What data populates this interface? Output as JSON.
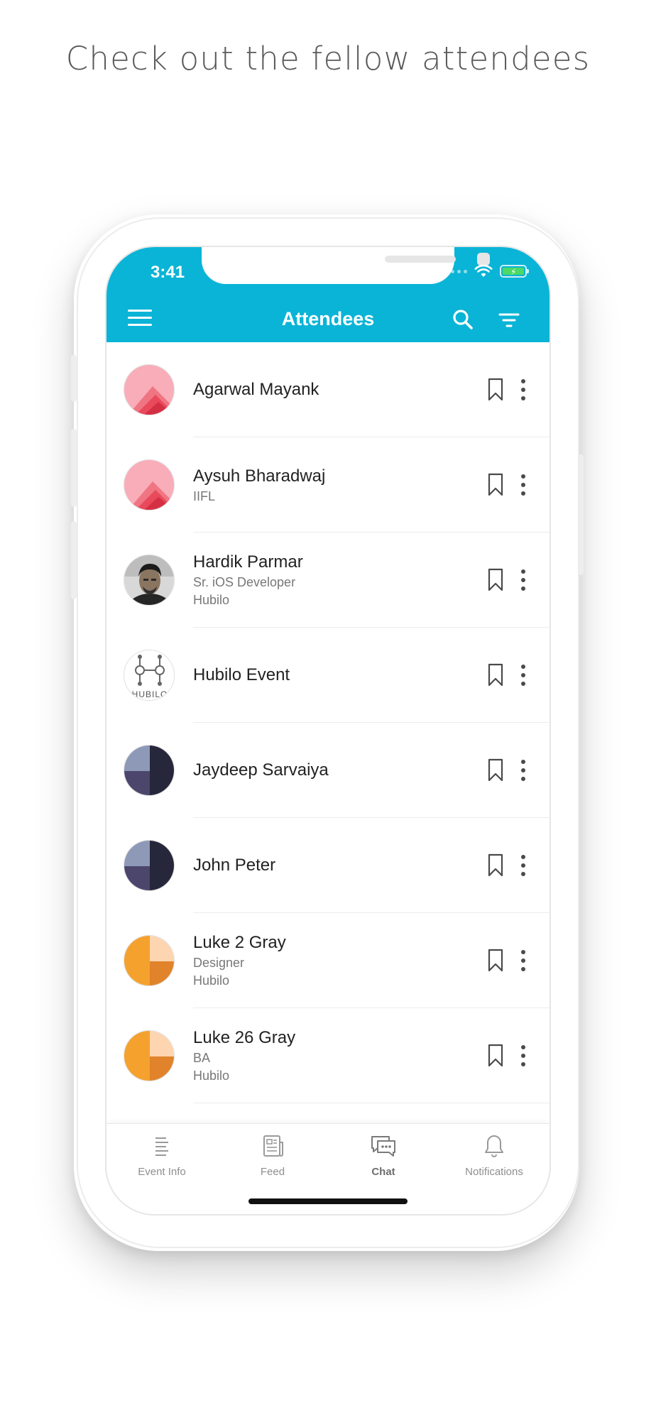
{
  "headline": "Check out the fellow attendees",
  "status_bar": {
    "time": "3:41"
  },
  "app_bar": {
    "title": "Attendees"
  },
  "colors": {
    "primary": "#0ab4d6",
    "text_primary": "#222222",
    "text_secondary": "#777777"
  },
  "attendees": [
    {
      "name": "Agarwal Mayank",
      "line1": "",
      "line2": "",
      "avatar": "pink-mountain-avatar"
    },
    {
      "name": "Aysuh Bharadwaj",
      "line1": "IIFL",
      "line2": "",
      "avatar": "pink-mountain-avatar"
    },
    {
      "name": "Hardik Parmar",
      "line1": "Sr. iOS Developer",
      "line2": "Hubilo",
      "avatar": "photo-avatar"
    },
    {
      "name": "Hubilo Event",
      "line1": "",
      "line2": "",
      "avatar": "hubilo-logo-avatar",
      "logo_text": "HUBILO"
    },
    {
      "name": "Jaydeep Sarvaiya",
      "line1": "",
      "line2": "",
      "avatar": "navy-quadrant-avatar"
    },
    {
      "name": "John Peter",
      "line1": "",
      "line2": "",
      "avatar": "navy-quadrant-avatar"
    },
    {
      "name": "Luke 2 Gray",
      "line1": "Designer",
      "line2": "Hubilo",
      "avatar": "orange-quadrant-avatar"
    },
    {
      "name": "Luke 26 Gray",
      "line1": "BA",
      "line2": "Hubilo",
      "avatar": "orange-quadrant-avatar"
    }
  ],
  "tabs": [
    {
      "label": "Event Info",
      "icon": "document-lines-icon",
      "active": false
    },
    {
      "label": "Feed",
      "icon": "newspaper-icon",
      "active": false
    },
    {
      "label": "Chat",
      "icon": "chat-bubbles-icon",
      "active": true
    },
    {
      "label": "Notifications",
      "icon": "bell-icon",
      "active": false
    }
  ]
}
